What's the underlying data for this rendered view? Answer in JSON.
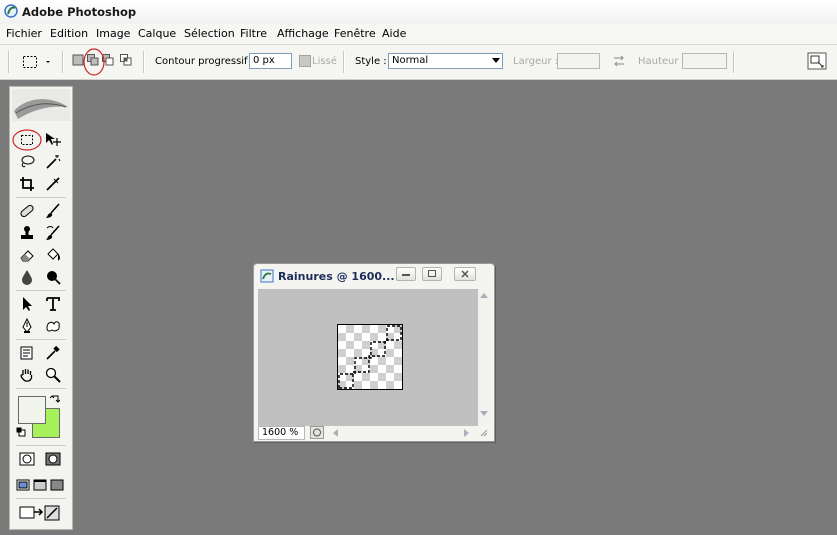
{
  "window": {
    "title": "Adobe Photoshop"
  },
  "menubar": {
    "items": [
      {
        "label": "Fichier"
      },
      {
        "label": "Edition"
      },
      {
        "label": "Image"
      },
      {
        "label": "Calque"
      },
      {
        "label": "Sélection"
      },
      {
        "label": "Filtre"
      },
      {
        "label": "Affichage"
      },
      {
        "label": "Fenêtre"
      },
      {
        "label": "Aide"
      }
    ]
  },
  "options": {
    "feather_label": "Contour progressif :",
    "feather_value": "0 px",
    "antialias_label": "Lissé",
    "style_label": "Style :",
    "style_value": "Normal",
    "width_label": "Largeur :",
    "height_label": "Hauteur :",
    "width_value": "",
    "height_value": ""
  },
  "document": {
    "title": "Rainures @ 1600...",
    "zoom": "1600 %"
  },
  "colors": {
    "foreground": "#f0f4ea",
    "background": "#a6f05c",
    "highlight_circle": "#cc2222"
  }
}
